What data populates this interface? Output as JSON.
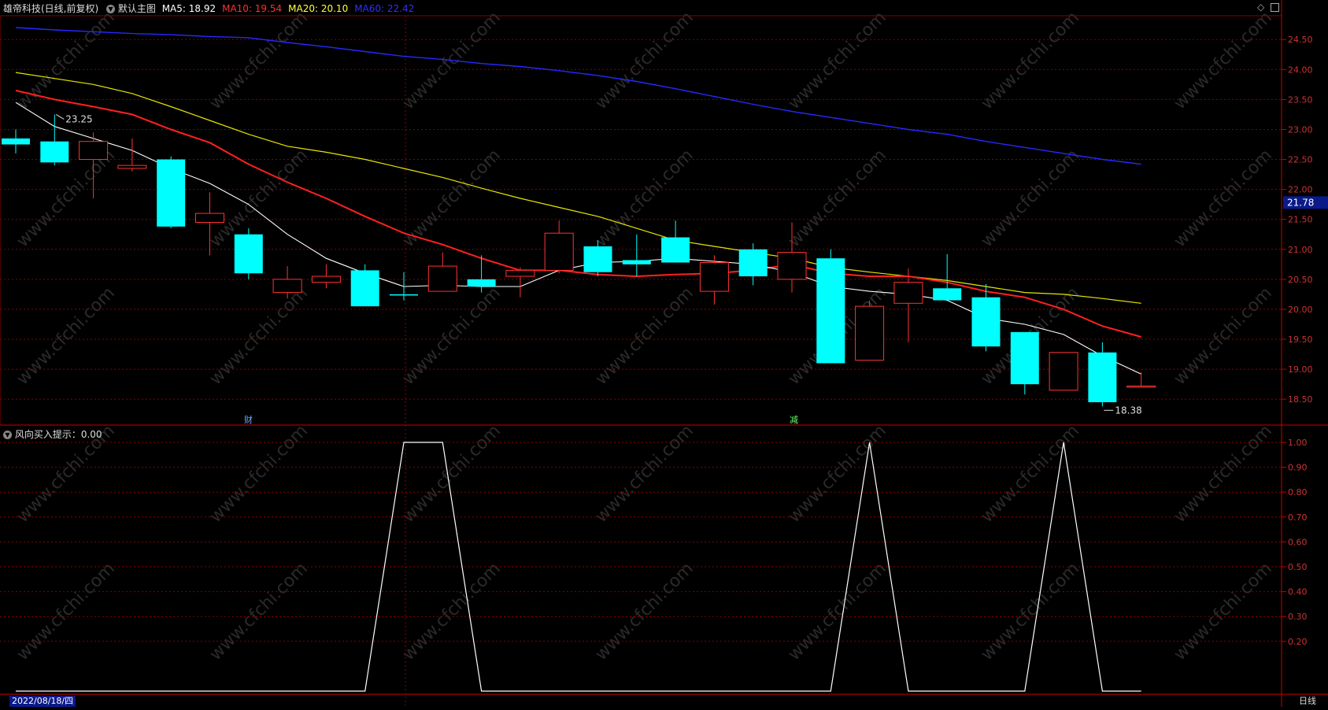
{
  "header": {
    "stock_title": "雄帝科技(日线,前复权)",
    "main_chart_label": "默认主图",
    "ma_labels": [
      {
        "text": "MA5: 18.92",
        "color": "#ffffff"
      },
      {
        "text": "MA10: 19.54",
        "color": "#ff3030"
      },
      {
        "text": "MA20: 20.10",
        "color": "#ffff40"
      },
      {
        "text": "MA60: 22.42",
        "color": "#3030ff"
      }
    ]
  },
  "indicator": {
    "label": "风向买入提示：0.00"
  },
  "footer": {
    "date": "2022/08/18/四",
    "period": "日线"
  },
  "price_axis_labels": [
    "24.50",
    "24.00",
    "23.50",
    "23.00",
    "22.50",
    "22.00",
    "21.50",
    "21.00",
    "20.50",
    "20.00",
    "19.50",
    "19.00",
    "18.50"
  ],
  "indicator_axis_labels": [
    "1.00",
    "0.90",
    "0.80",
    "0.70",
    "0.60",
    "0.50",
    "0.40",
    "0.30",
    "0.20"
  ],
  "watermark": "www.cfchi.com",
  "markers": {
    "fin": "财",
    "reduce": "减"
  },
  "colors": {
    "up": "#ff3232",
    "down": "#00ffff",
    "ma5": "#ffffff",
    "ma10": "#ff2020",
    "ma20": "#e6e600",
    "ma60": "#2828ff",
    "grid": "#8b0000"
  },
  "chart_data": [
    {
      "type": "candlestick",
      "y_range": [
        18.2,
        24.7
      ],
      "candles": [
        {
          "o": 22.85,
          "h": 23.0,
          "l": 22.6,
          "c": 22.75
        },
        {
          "o": 22.8,
          "h": 23.25,
          "l": 22.4,
          "c": 22.45
        },
        {
          "o": 22.5,
          "h": 22.95,
          "l": 21.85,
          "c": 22.8
        },
        {
          "o": 22.35,
          "h": 22.85,
          "l": 22.3,
          "c": 22.4
        },
        {
          "o": 22.5,
          "h": 22.55,
          "l": 21.35,
          "c": 21.38
        },
        {
          "o": 21.45,
          "h": 21.95,
          "l": 20.9,
          "c": 21.6
        },
        {
          "o": 21.25,
          "h": 21.35,
          "l": 20.5,
          "c": 20.6
        },
        {
          "o": 20.28,
          "h": 20.72,
          "l": 20.18,
          "c": 20.5
        },
        {
          "o": 20.45,
          "h": 20.75,
          "l": 20.35,
          "c": 20.55
        },
        {
          "o": 20.65,
          "h": 20.75,
          "l": 20.05,
          "c": 20.05
        },
        {
          "o": 20.25,
          "h": 20.62,
          "l": 20.15,
          "c": 20.23
        },
        {
          "o": 20.3,
          "h": 20.95,
          "l": 20.3,
          "c": 20.72
        },
        {
          "o": 20.5,
          "h": 20.9,
          "l": 20.28,
          "c": 20.38
        },
        {
          "o": 20.55,
          "h": 20.7,
          "l": 20.2,
          "c": 20.65
        },
        {
          "o": 20.65,
          "h": 21.48,
          "l": 20.6,
          "c": 21.27
        },
        {
          "o": 21.05,
          "h": 21.15,
          "l": 20.55,
          "c": 20.62
        },
        {
          "o": 20.82,
          "h": 21.25,
          "l": 20.55,
          "c": 20.75
        },
        {
          "o": 21.2,
          "h": 21.48,
          "l": 20.8,
          "c": 20.78
        },
        {
          "o": 20.3,
          "h": 20.9,
          "l": 20.08,
          "c": 20.78
        },
        {
          "o": 21.0,
          "h": 21.1,
          "l": 20.4,
          "c": 20.55
        },
        {
          "o": 20.5,
          "h": 21.45,
          "l": 20.28,
          "c": 20.95
        },
        {
          "o": 20.85,
          "h": 21.0,
          "l": 19.1,
          "c": 19.1
        },
        {
          "o": 19.15,
          "h": 20.15,
          "l": 19.15,
          "c": 20.05
        },
        {
          "o": 20.1,
          "h": 20.68,
          "l": 19.45,
          "c": 20.45
        },
        {
          "o": 20.35,
          "h": 20.92,
          "l": 20.15,
          "c": 20.15
        },
        {
          "o": 20.2,
          "h": 20.42,
          "l": 19.3,
          "c": 19.38
        },
        {
          "o": 19.62,
          "h": 19.62,
          "l": 18.58,
          "c": 18.75
        },
        {
          "o": 18.65,
          "h": 19.28,
          "l": 18.65,
          "c": 19.28
        },
        {
          "o": 19.28,
          "h": 19.45,
          "l": 18.38,
          "c": 18.45
        },
        {
          "o": 18.72,
          "h": 18.95,
          "l": 18.72,
          "c": 18.72
        }
      ],
      "ma5": [
        23.45,
        23.05,
        22.85,
        22.65,
        22.35,
        22.1,
        21.75,
        21.25,
        20.85,
        20.6,
        20.38,
        20.4,
        20.38,
        20.38,
        20.65,
        20.78,
        20.8,
        20.85,
        20.8,
        20.75,
        20.62,
        20.38,
        20.3,
        20.25,
        20.15,
        19.85,
        19.75,
        19.58,
        19.22,
        18.92
      ],
      "ma10": [
        23.65,
        23.5,
        23.38,
        23.25,
        23.0,
        22.78,
        22.42,
        22.12,
        21.85,
        21.55,
        21.27,
        21.08,
        20.85,
        20.65,
        20.65,
        20.58,
        20.55,
        20.58,
        20.6,
        20.65,
        20.75,
        20.6,
        20.55,
        20.55,
        20.45,
        20.3,
        20.2,
        20.0,
        19.72,
        19.54
      ],
      "ma20": [
        23.95,
        23.85,
        23.75,
        23.6,
        23.38,
        23.15,
        22.92,
        22.72,
        22.62,
        22.5,
        22.35,
        22.2,
        22.02,
        21.85,
        21.7,
        21.55,
        21.35,
        21.15,
        21.05,
        20.95,
        20.85,
        20.7,
        20.62,
        20.55,
        20.48,
        20.38,
        20.28,
        20.25,
        20.18,
        20.1
      ],
      "ma60": [
        24.7,
        24.66,
        24.63,
        24.6,
        24.58,
        24.55,
        24.53,
        24.45,
        24.38,
        24.3,
        24.22,
        24.17,
        24.1,
        24.05,
        23.98,
        23.9,
        23.8,
        23.68,
        23.55,
        23.42,
        23.3,
        23.2,
        23.1,
        23.0,
        22.92,
        22.8,
        22.7,
        22.6,
        22.5,
        22.42
      ],
      "annotations": [
        {
          "text": "23.25",
          "index": 1,
          "value": 23.25
        },
        {
          "text": "18.38",
          "index": 28,
          "value": 18.38
        },
        {
          "text": "21.78",
          "value": 21.78
        }
      ]
    },
    {
      "type": "line",
      "name": "风向买入提示",
      "y_range": [
        0,
        1.0
      ],
      "values": [
        0,
        0,
        0,
        0,
        0,
        0,
        0,
        0,
        0,
        0,
        1,
        1,
        0,
        0,
        0,
        0,
        0,
        0,
        0,
        0,
        0,
        0,
        1,
        0,
        0,
        0,
        0,
        1,
        0,
        0
      ]
    }
  ]
}
